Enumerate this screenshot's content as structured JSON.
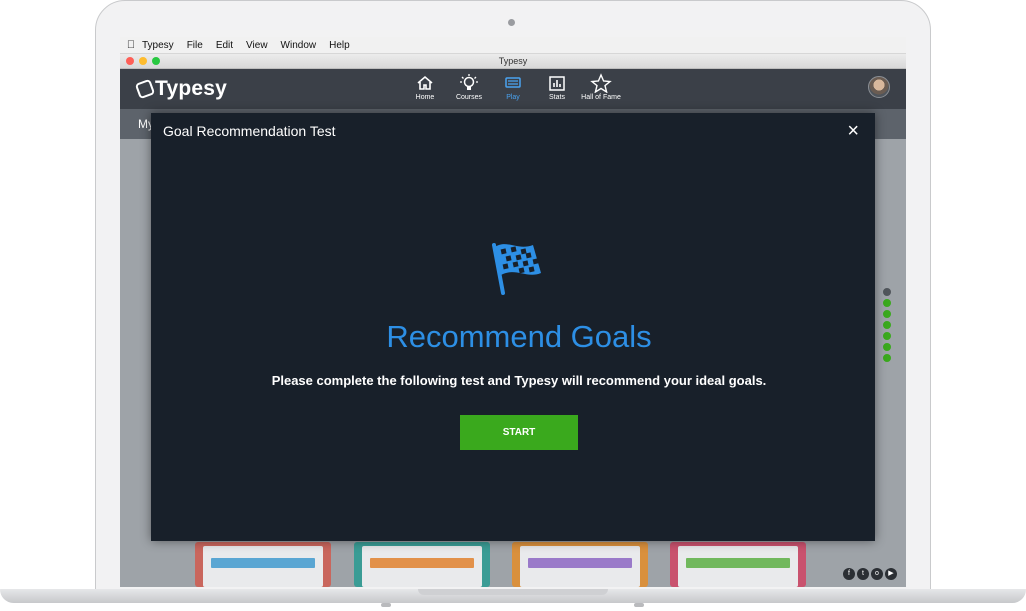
{
  "mac_menu": {
    "items": [
      "Typesy",
      "File",
      "Edit",
      "View",
      "Window",
      "Help"
    ]
  },
  "window": {
    "title": "Typesy"
  },
  "app": {
    "logo": "Typesy",
    "nav": [
      {
        "label": "Home",
        "icon": "home-icon",
        "active": false
      },
      {
        "label": "Courses",
        "icon": "lightbulb-icon",
        "active": false
      },
      {
        "label": "Play",
        "icon": "keyboard-icon",
        "active": true
      },
      {
        "label": "Stats",
        "icon": "stats-icon",
        "active": false
      },
      {
        "label": "Hall of Fame",
        "icon": "star-icon",
        "active": false
      }
    ],
    "page_heading_partial": "My"
  },
  "modal": {
    "title": "Goal Recommendation Test",
    "close": "×",
    "headline": "Recommend Goals",
    "description": "Please complete the following test and Typesy will recommend your ideal goals.",
    "button": "START"
  },
  "colors": {
    "accent_blue": "#2d8fe5",
    "start_green": "#3aa91d",
    "modal_bg": "#18202a",
    "nav_bg": "#3b4048"
  }
}
